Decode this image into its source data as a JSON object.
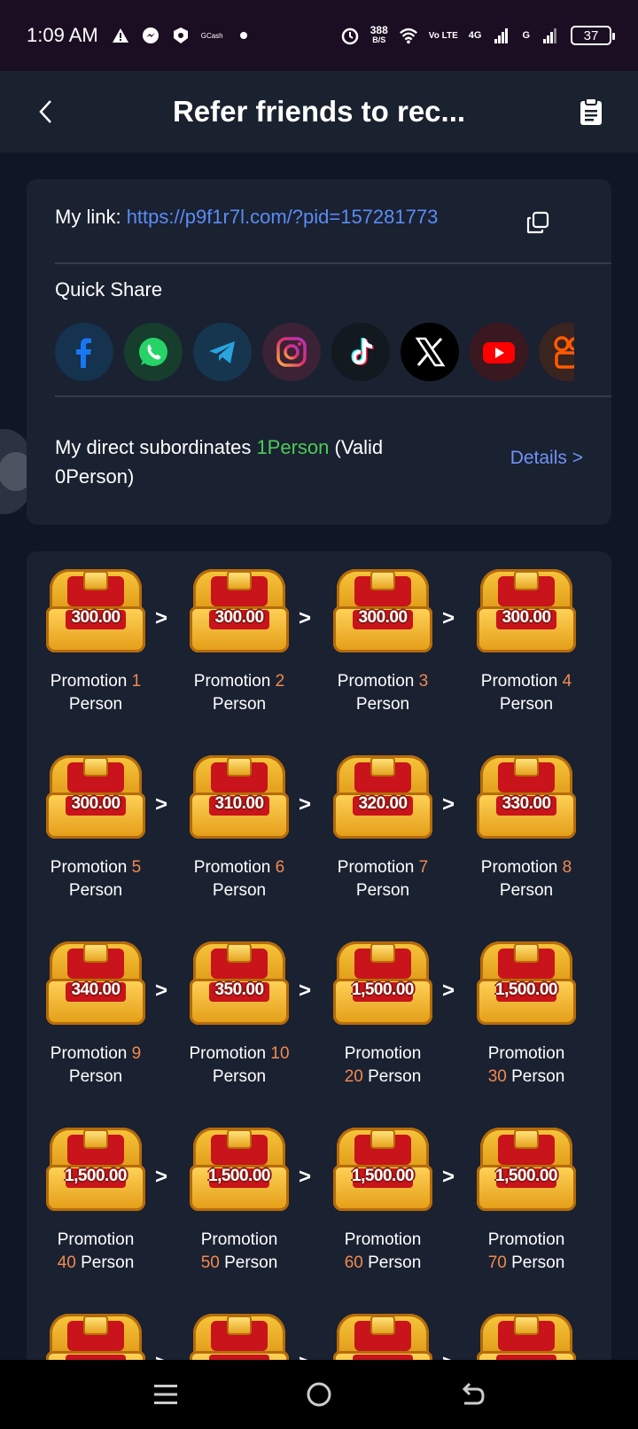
{
  "status_bar": {
    "time": "1:09 AM",
    "gcash_label": "GCash",
    "net_speed": "388",
    "net_unit": "B/S",
    "volte": "Vo LTE",
    "net1": "4G",
    "net2": "G",
    "battery": "37"
  },
  "header": {
    "title": "Refer friends to rec..."
  },
  "link_card": {
    "link_label": "My link: ",
    "link_url": "https://p9f1r7l.com/?pid=157281773",
    "quick_share_label": "Quick Share",
    "share_targets": [
      {
        "name": "facebook",
        "color": "#1877f2"
      },
      {
        "name": "whatsapp",
        "color": "#25d366"
      },
      {
        "name": "telegram",
        "color": "#2aa3df"
      },
      {
        "name": "instagram",
        "color": "#d6249f"
      },
      {
        "name": "tiktok",
        "color": "#000000"
      },
      {
        "name": "x",
        "color": "#000000"
      },
      {
        "name": "youtube",
        "color": "#ff0000"
      },
      {
        "name": "kuaishou",
        "color": "#ff5a00"
      }
    ],
    "subordinates_prefix": "My direct subordinates ",
    "subordinates_count": "1Person",
    "subordinates_valid": " (Valid 0Person)",
    "details_label": "Details >"
  },
  "rewards": {
    "label_word": "Promotion",
    "person_word": "Person",
    "separator": ">",
    "items": [
      {
        "amount": "300.00",
        "count": "1"
      },
      {
        "amount": "300.00",
        "count": "2"
      },
      {
        "amount": "300.00",
        "count": "3"
      },
      {
        "amount": "300.00",
        "count": "4"
      },
      {
        "amount": "300.00",
        "count": "5"
      },
      {
        "amount": "310.00",
        "count": "6"
      },
      {
        "amount": "320.00",
        "count": "7"
      },
      {
        "amount": "330.00",
        "count": "8"
      },
      {
        "amount": "340.00",
        "count": "9"
      },
      {
        "amount": "350.00",
        "count": "10"
      },
      {
        "amount": "1,500.00",
        "count": "20"
      },
      {
        "amount": "1,500.00",
        "count": "30"
      },
      {
        "amount": "1,500.00",
        "count": "40"
      },
      {
        "amount": "1,500.00",
        "count": "50"
      },
      {
        "amount": "1,500.00",
        "count": "60"
      },
      {
        "amount": "1,500.00",
        "count": "70"
      }
    ]
  }
}
